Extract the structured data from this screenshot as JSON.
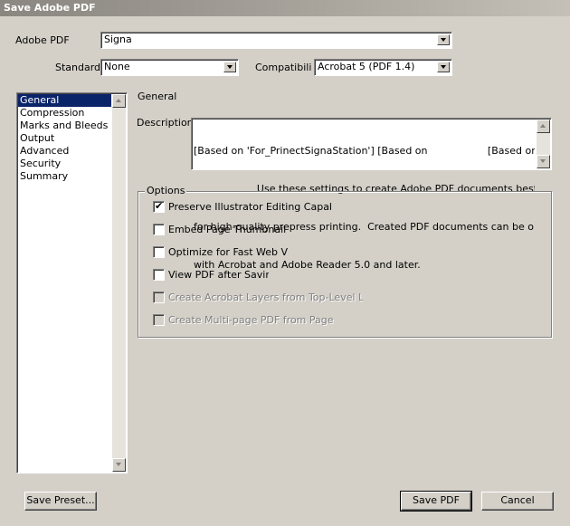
{
  "window": {
    "title": "Save Adobe PDF"
  },
  "header": {
    "adobe_pdf_label": "Adobe PDF",
    "adobe_pdf_value": "Signa",
    "standard_label": "Standard",
    "standard_value": "None",
    "compat_label": "Compatibilit",
    "compat_value": "Acrobat 5 (PDF 1.4)"
  },
  "sidebar": {
    "items": [
      {
        "label": "General",
        "selected": true
      },
      {
        "label": "Compression"
      },
      {
        "label": "Marks and Bleeds"
      },
      {
        "label": "Output"
      },
      {
        "label": "Advanced"
      },
      {
        "label": "Security"
      },
      {
        "label": "Summary"
      }
    ]
  },
  "panel": {
    "title": "General",
    "description_label": "Description",
    "description_lines": [
      "[Based on 'For_PrinectSignaStation'] [Based on                   [Based on",
      "                    Use these settings to create Adobe PDF documents best suited",
      "for high-quality prepress printing.  Created PDF documents can be opened",
      "with Acrobat and Adobe Reader 5.0 and later."
    ],
    "options_title": "Options",
    "options": [
      {
        "label": "Preserve Illustrator Editing Capabil",
        "checked": true,
        "enabled": true
      },
      {
        "label": "Embed Page Thumbnail",
        "checked": false,
        "enabled": true
      },
      {
        "label": "Optimize for Fast Web Vi",
        "checked": false,
        "enabled": true
      },
      {
        "label": "View PDF after Savir",
        "checked": false,
        "enabled": true
      },
      {
        "label": "Create Acrobat Layers from Top-Level La",
        "checked": false,
        "enabled": false
      },
      {
        "label": "Create Multi-page PDF from Page T",
        "checked": false,
        "enabled": false
      }
    ]
  },
  "footer": {
    "save_preset_label": "Save Preset...",
    "save_pdf_label": "Save PDF",
    "cancel_label": "Cancel"
  },
  "icons": {
    "check": "checkmark-icon",
    "dropdown": "chevron-down-icon"
  },
  "colors": {
    "selection": "#0a246a",
    "dialog_bg": "#d4d0c8"
  }
}
